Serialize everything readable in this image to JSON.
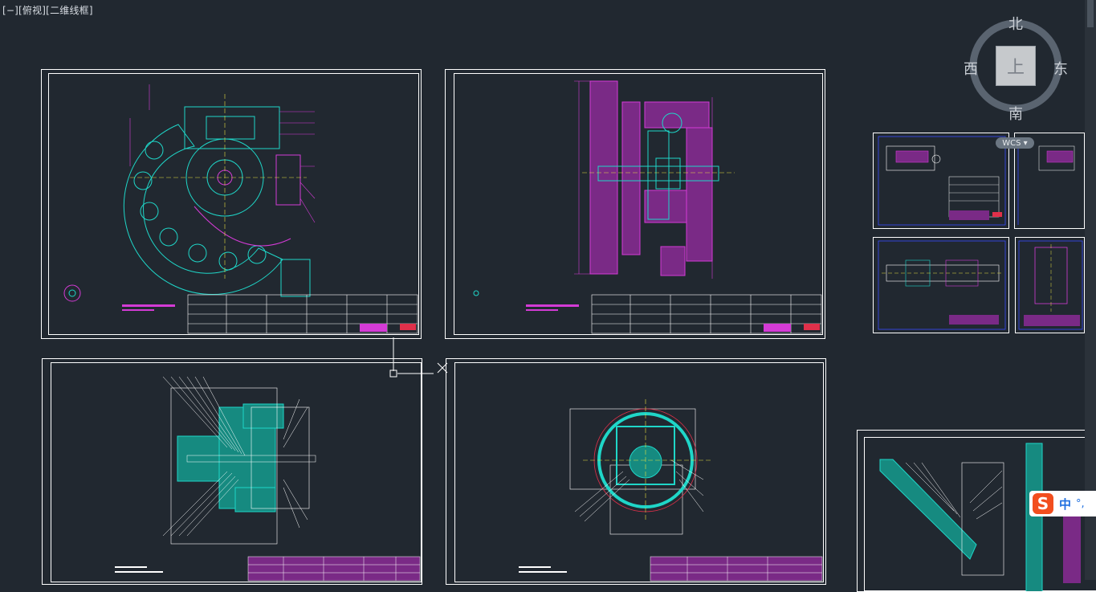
{
  "viewport": {
    "label": "[−][俯视][二维线框]"
  },
  "viewcube": {
    "north": "北",
    "south": "南",
    "east": "东",
    "west": "西",
    "top_face": "上",
    "wcs": "WCS ▾"
  },
  "ime": {
    "mode": "中",
    "symbols": "°,"
  },
  "colors": {
    "background": "#212830",
    "frame": "#ffffff",
    "cyan": "#1fd6c8",
    "magenta": "#d43bd6",
    "blue": "#3a4dff",
    "yellow": "#e8e040",
    "red": "#e0304a",
    "green": "#2fc068"
  },
  "sheets": [
    {
      "id": "sheet-1",
      "content": "cam-assembly"
    },
    {
      "id": "sheet-2",
      "content": "gearbox-section"
    },
    {
      "id": "sheet-3",
      "content": "reducer-assembly"
    },
    {
      "id": "sheet-4",
      "content": "flange-section"
    },
    {
      "id": "sheet-5",
      "content": "part-detail-a"
    },
    {
      "id": "sheet-6",
      "content": "part-detail-b"
    },
    {
      "id": "sheet-7",
      "content": "shaft-detail"
    },
    {
      "id": "sheet-8",
      "content": "housing-detail"
    },
    {
      "id": "sheet-9",
      "content": "inclined-assembly"
    }
  ]
}
